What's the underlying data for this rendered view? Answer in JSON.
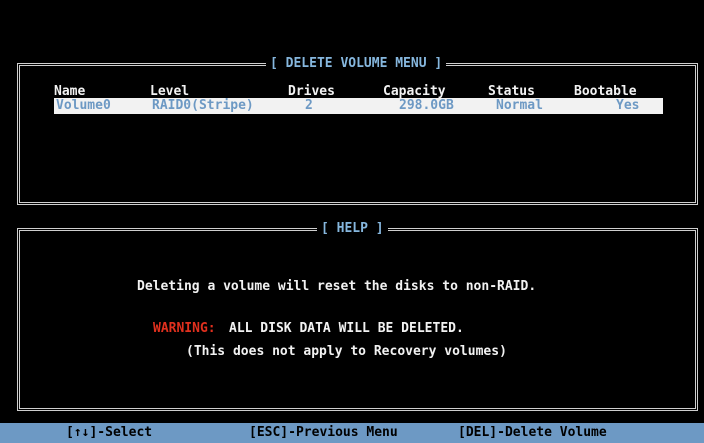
{
  "volume_menu": {
    "title": "[ DELETE VOLUME MENU ]",
    "columns": [
      "Name",
      "Level",
      "Drives",
      "Capacity",
      "Status",
      "Bootable"
    ],
    "rows": [
      {
        "name": "Volume0",
        "level": "RAID0(Stripe)",
        "drives": "2",
        "capacity": "298.0GB",
        "status": "Normal",
        "bootable": "Yes"
      }
    ]
  },
  "help": {
    "title": "[ HELP ]",
    "line1": "Deleting a volume will reset the disks to non-RAID.",
    "warning_label": "WARNING:",
    "warning_text": "ALL DISK DATA WILL BE DELETED.",
    "note": "(This does not apply to Recovery volumes)"
  },
  "footer": {
    "select": "[↑↓]-Select",
    "previous": "[ESC]-Previous Menu",
    "delete": "[DEL]-Delete Volume"
  },
  "colors": {
    "background": "#000000",
    "frame": "#cfcfcf",
    "title_text": "#86b7de",
    "selection_bg": "#f2f2f2",
    "selection_text": "#6d99c4",
    "footer_bg": "#6d99c4",
    "warning": "#e0301e"
  }
}
